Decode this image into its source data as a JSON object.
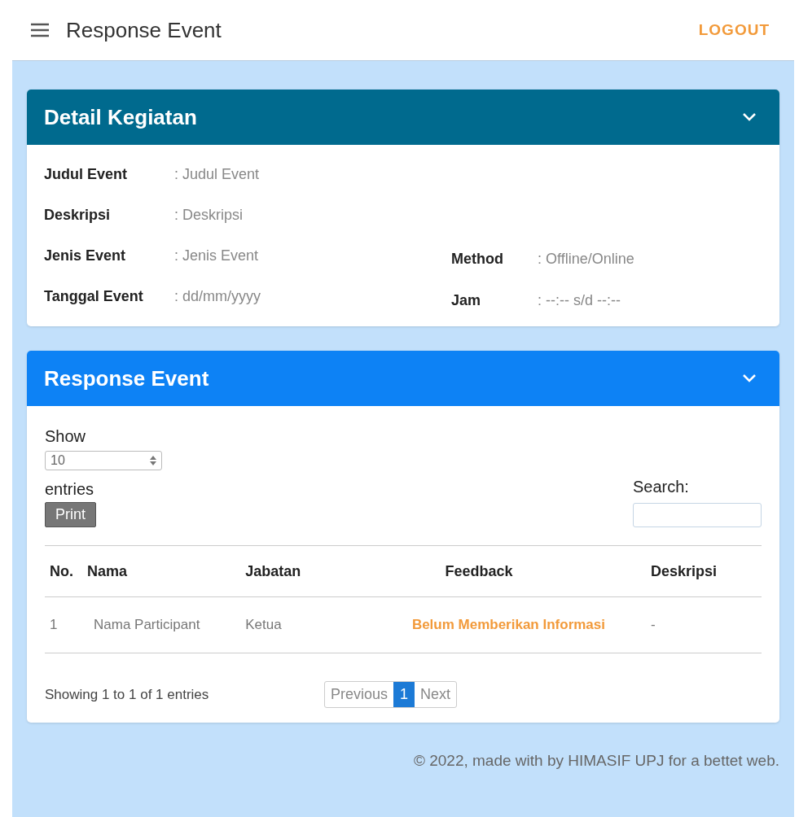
{
  "topbar": {
    "title": "Response Event",
    "logout": "LOGOUT"
  },
  "detail_card": {
    "title": "Detail Kegiatan",
    "expanded": true,
    "left_fields": [
      {
        "label": "Judul Event",
        "value": ": Judul Event"
      },
      {
        "label": "Deskripsi",
        "value": ": Deskripsi"
      },
      {
        "label": "Jenis Event",
        "value": ": Jenis Event"
      },
      {
        "label": "Tanggal Event",
        "value": ": dd/mm/yyyy"
      }
    ],
    "right_fields": [
      {
        "label": "Method",
        "value": ": Offline/Online"
      },
      {
        "label": "Jam",
        "value": ": --:-- s/d --:--"
      }
    ]
  },
  "response_card": {
    "title": "Response Event",
    "expanded": true,
    "show_label": "Show",
    "entries_select": "10",
    "entries_label": "entries",
    "print_button": "Print",
    "search_label": "Search:",
    "table": {
      "columns": [
        "No.",
        "Nama",
        "Jabatan",
        "Feedback",
        "Deskripsi"
      ],
      "rows": [
        {
          "cells": [
            "1",
            "Nama Participant",
            "Ketua",
            "Belum Memberikan Informasi",
            "-"
          ]
        }
      ]
    },
    "info": "Showing 1 to 1 of 1 entries",
    "pagination": [
      {
        "label": "Previous",
        "selected": false
      },
      {
        "label": "1",
        "selected": true
      },
      {
        "label": "Next",
        "selected": false
      }
    ]
  },
  "footer": "© 2022, made with by HIMASIF UPJ for a bettet web."
}
